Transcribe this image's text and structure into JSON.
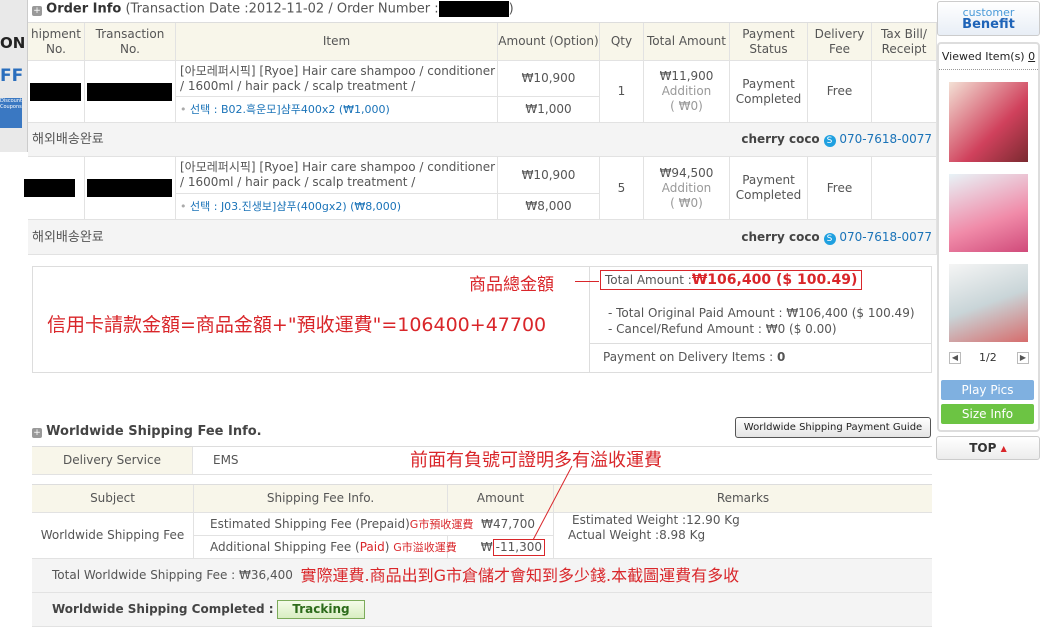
{
  "promo": {
    "line1": "ON",
    "line2": "FF",
    "coupon": "Discount Coupons"
  },
  "order": {
    "title": "Order Info",
    "subtitle_prefix": "(Transaction Date :2012-11-02 / Order Number :",
    "subtitle_suffix": ")"
  },
  "columns": [
    "hipment No.",
    "Transaction No.",
    "Item",
    "Amount (Option)",
    "Qty",
    "Total Amount",
    "Payment Status",
    "Delivery Fee",
    "Tax Bill/ Receipt"
  ],
  "items": [
    {
      "item": "[아모레퍼시픽] [Ryoe] Hair care shampoo / conditioner / 1600ml / hair pack / scalp treatment /",
      "option": "선택 : B02.흑운모]샴푸400x2 (₩1,000)",
      "amount": "₩10,900",
      "option_amount": "₩1,000",
      "qty": "1",
      "total": "₩11,900",
      "addition": "Addition",
      "addition_val": "( ₩0)",
      "status": "Payment Completed",
      "delivery": "Free",
      "ship_status": "해외배송완료",
      "seller": "cherry coco",
      "phone": "070-7618-0077"
    },
    {
      "item": "[아모레퍼시픽] [Ryoe] Hair care shampoo / conditioner / 1600ml / hair pack / scalp treatment /",
      "option": "선택 : J03.진생보]샴푸(400gx2) (₩8,000)",
      "amount": "₩10,900",
      "option_amount": "₩8,000",
      "qty": "5",
      "total": "₩94,500",
      "addition": "Addition",
      "addition_val": "( ₩0)",
      "status": "Payment Completed",
      "delivery": "Free",
      "ship_status": "해외배송완료",
      "seller": "cherry coco",
      "phone": "070-7618-0077"
    }
  ],
  "summary": {
    "total_label": "Total Amount :",
    "total_value": "₩106,400 ($ 100.49)",
    "orig": "- Total Original Paid Amount : ₩106,400 ($ 100.49)",
    "cancel": "- Cancel/Refund Amount : ₩0 ($ 0.00)",
    "cod_label": "Payment on Delivery Items :",
    "cod_value": "0"
  },
  "shipping": {
    "title": "Worldwide Shipping Fee Info.",
    "guide_button": "Worldwide Shipping Payment Guide",
    "delivery_label": "Delivery Service",
    "delivery_value": "EMS",
    "headers": [
      "Subject",
      "Shipping Fee Info.",
      "Amount",
      "Remarks"
    ],
    "subject": "Worldwide Shipping Fee",
    "est_label": "Estimated Shipping Fee (Prepaid)",
    "est_amount": "₩47,700",
    "add_label_a": "Additional Shipping Fee (",
    "add_label_b": "Paid",
    "add_label_c": ")",
    "add_amount_prefix": "₩",
    "add_amount": "-11,300",
    "est_weight": "Estimated Weight :12.90 Kg",
    "act_weight": "Actual Weight :8.98 Kg",
    "total_label": "Total Worldwide Shipping Fee : ₩36,400",
    "completed_label": "Worldwide Shipping Completed :",
    "tracking": "Tracking"
  },
  "annotations": {
    "product_total": "商品總金額",
    "credit": "信用卡請款金額=商品金額+\"預收運費\"=106400+47700",
    "negative": "前面有負號可證明多有溢收運費",
    "prepaid": "G市預收運費",
    "overpaid": "G市溢收運費",
    "actual": "實際運費.商品出到G市倉儲才會知到多少錢.本截圖運費有多收"
  },
  "sidebar": {
    "benefit_top": "customer",
    "benefit_bottom": "Benefit",
    "viewed": "Viewed Item(s)",
    "viewed_count": "0",
    "page": "1/2",
    "play": "Play Pics",
    "size": "Size Info",
    "top": "TOP"
  },
  "colors": {
    "accent": "#d9262a",
    "link": "#1a73b8",
    "header_bg": "#f8f6ea"
  }
}
